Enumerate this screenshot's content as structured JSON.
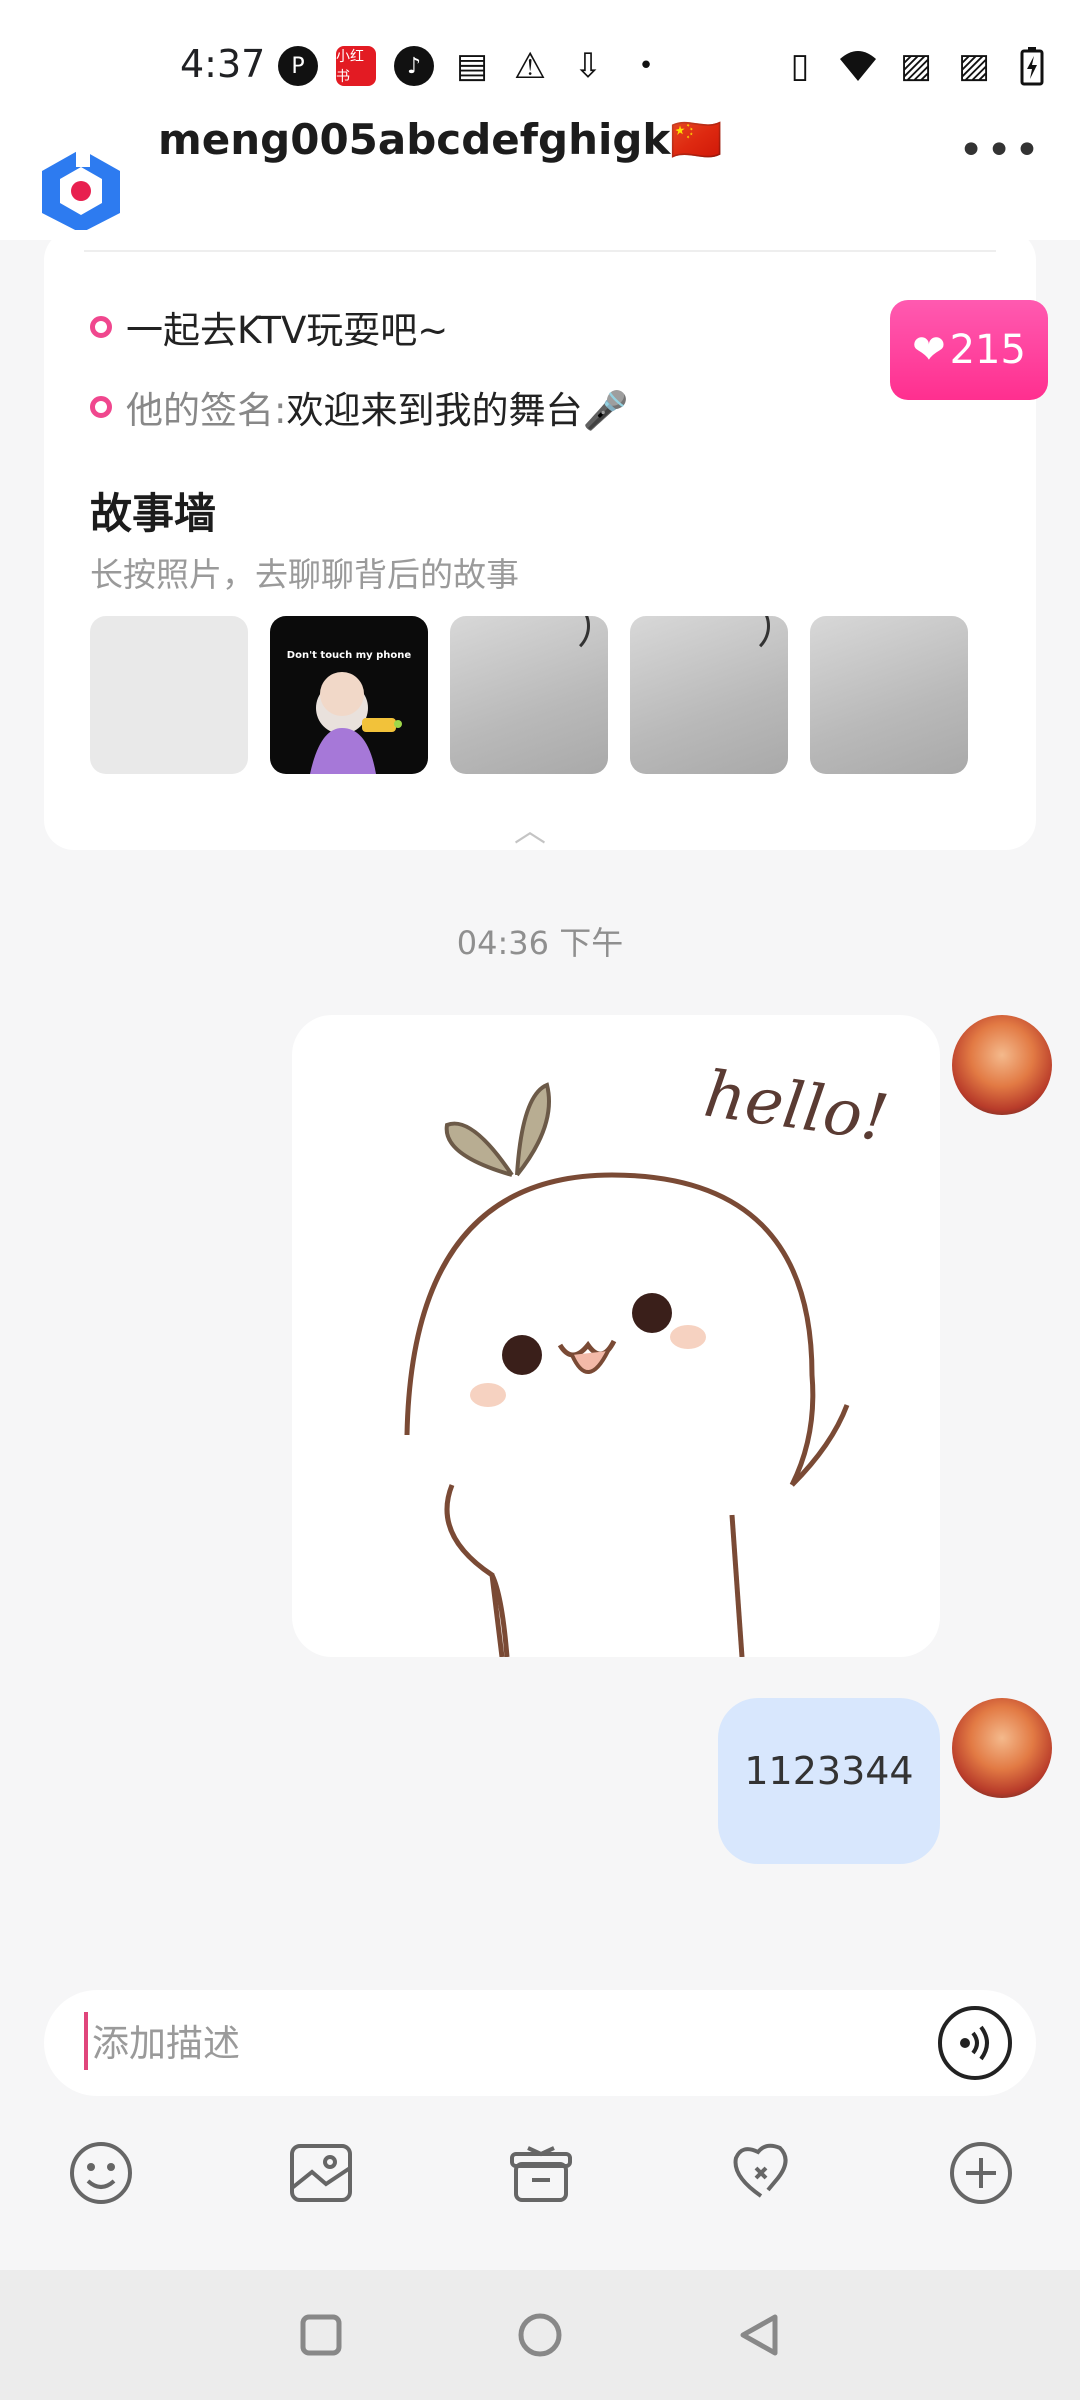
{
  "status_bar": {
    "time": "4:37",
    "icons_left": [
      "p-icon",
      "xiaohongshu-icon",
      "tiktok-icon",
      "wallet-icon",
      "warning-icon",
      "download-icon",
      "dot-icon"
    ],
    "icons_right": [
      "vibrate-icon",
      "wifi-icon",
      "no-sim-icon",
      "no-sim-icon",
      "battery-charging-icon"
    ],
    "xiaohongshu_label": "小红书"
  },
  "header": {
    "title": "meng005abcdefghigk🇨🇳",
    "more_label": "•••"
  },
  "profile": {
    "line1": "一起去KTV玩耍吧~",
    "signature_label": "他的签名: ",
    "signature_value": "欢迎来到我的舞台🎤",
    "likes": "215",
    "story_wall_title": "故事墙",
    "story_wall_subtitle": "长按照片，去聊聊背后的故事",
    "photo_caption": "Don't touch my phone"
  },
  "chat": {
    "timestamp": "04:36 下午",
    "sticker_text": "hello!",
    "message_text": "1123344"
  },
  "input": {
    "placeholder": "添加描述",
    "value": ""
  },
  "toolbar": {
    "items": [
      "emoji-icon",
      "image-icon",
      "gift-icon",
      "heart-icon",
      "plus-icon"
    ]
  },
  "colors": {
    "accent_pink": "#ff2f8f",
    "bubble_blue": "#d8e7fd",
    "background": "#f6f6f7"
  }
}
